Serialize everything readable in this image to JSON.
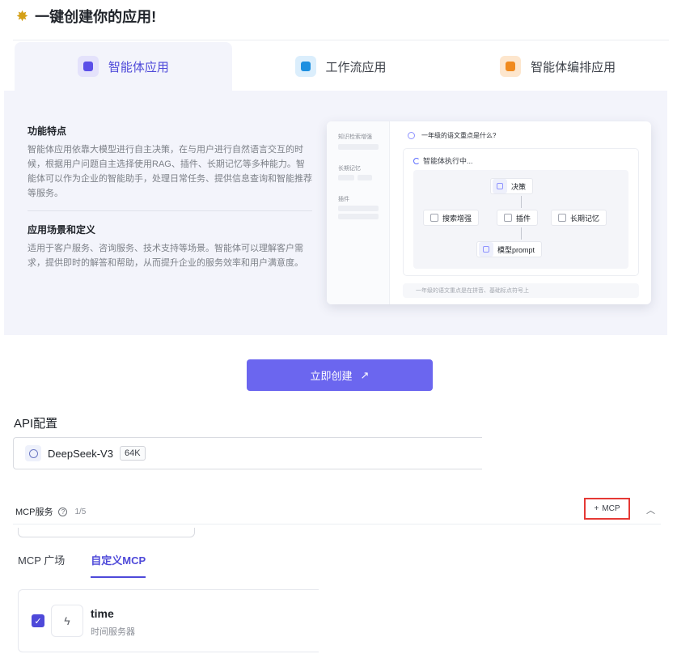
{
  "header": {
    "title": "一键创建你的应用!",
    "icon": "sparkle-icon"
  },
  "tabs": [
    {
      "label": "智能体应用",
      "icon": "agent-app-icon",
      "color": "#5b4fe8",
      "bg": "#e4e2fb",
      "active": true
    },
    {
      "label": "工作流应用",
      "icon": "workflow-app-icon",
      "color": "#1d8fe0",
      "bg": "#dbeefc",
      "active": false
    },
    {
      "label": "智能体编排应用",
      "icon": "orchestration-app-icon",
      "color": "#f08a1e",
      "bg": "#fde6cd",
      "active": false
    }
  ],
  "features": {
    "heading1": "功能特点",
    "text1": "智能体应用依靠大模型进行自主决策，在与用户进行自然语言交互的时候，根据用户问题自主选择使用RAG、插件、长期记忆等多种能力。智能体可以作为企业的智能助手，处理日常任务、提供信息查询和智能推荐等服务。",
    "heading2": "应用场景和定义",
    "text2": "适用于客户服务、咨询服务、技术支持等场景。智能体可以理解客户需求，提供即时的解答和帮助，从而提升企业的服务效率和用户满意度。"
  },
  "preview": {
    "side_labels": [
      "知识检索增强",
      "长期记忆",
      "插件"
    ],
    "question": "一年级的语文重点是什么?",
    "running": "智能体执行中...",
    "nodes": {
      "decision": "决策",
      "search": "搜索增强",
      "plugin": "插件",
      "memory": "长期记忆",
      "model": "模型prompt"
    },
    "input_hint": "一年级的语文重点是在拼音、基础标点符号上"
  },
  "create_button": {
    "label": "立即创建",
    "arrow": "↗"
  },
  "api": {
    "title": "API配置",
    "model_name": "DeepSeek-V3",
    "model_tag": "64K"
  },
  "mcp": {
    "label": "MCP服务",
    "count": "1/5",
    "add_label": "MCP",
    "tabs": [
      {
        "label": "MCP 广场",
        "active": false
      },
      {
        "label": "自定义MCP",
        "active": true
      }
    ],
    "tool": {
      "name": "time",
      "desc": "时间服务器",
      "checked": true
    }
  }
}
